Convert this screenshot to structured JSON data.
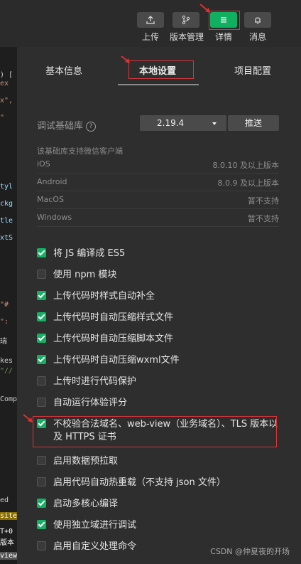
{
  "toolbar": {
    "upload_label": "上传",
    "version_label": "版本管理",
    "details_label": "详情",
    "messages_label": "消息",
    "accent_color": "#10b060"
  },
  "editor": {
    "lines": [
      ") [",
      "ex",
      "x\",",
      "\"",
      "tyl",
      "ckg",
      "tle",
      "xtS",
      "\"#",
      "\":",
      "瑞",
      "kes",
      "\"//",
      "Comp",
      "ed",
      "site",
      "T+0",
      "版本",
      "view"
    ]
  },
  "tabs": {
    "basic": "基本信息",
    "local": "本地设置",
    "project": "项目配置"
  },
  "lib": {
    "label": "调试基础库",
    "help": "?",
    "version": "2.19.4",
    "push": "推送",
    "note": "该基础库支持微信客户端"
  },
  "platforms": [
    {
      "name": "iOS",
      "value": "8.0.10 及以上版本"
    },
    {
      "name": "Android",
      "value": "8.0.9 及以上版本"
    },
    {
      "name": "MacOS",
      "value": "暂不支持"
    },
    {
      "name": "Windows",
      "value": "暂不支持"
    }
  ],
  "options": [
    {
      "label": "将 JS 编译成 ES5",
      "checked": true
    },
    {
      "label": "使用 npm 模块",
      "checked": false
    },
    {
      "label": "上传代码时样式自动补全",
      "checked": true
    },
    {
      "label": "上传代码时自动压缩样式文件",
      "checked": true
    },
    {
      "label": "上传代码时自动压缩脚本文件",
      "checked": true
    },
    {
      "label": "上传代码时自动压缩wxml文件",
      "checked": true
    },
    {
      "label": "上传时进行代码保护",
      "checked": false
    },
    {
      "label": "自动运行体验评分",
      "checked": false
    },
    {
      "label": "不校验合法域名、web-view（业务域名）、TLS 版本以及 HTTPS 证书",
      "checked": true
    },
    {
      "label": "启用数据预拉取",
      "checked": false
    },
    {
      "label": "启用代码自动热重载（不支持 json 文件）",
      "checked": false
    },
    {
      "label": "启动多核心编译",
      "checked": true
    },
    {
      "label": "使用独立域进行调试",
      "checked": true
    },
    {
      "label": "启用自定义处理命令",
      "checked": false
    }
  ],
  "watermark": "CSDN @仲夏夜的开场"
}
